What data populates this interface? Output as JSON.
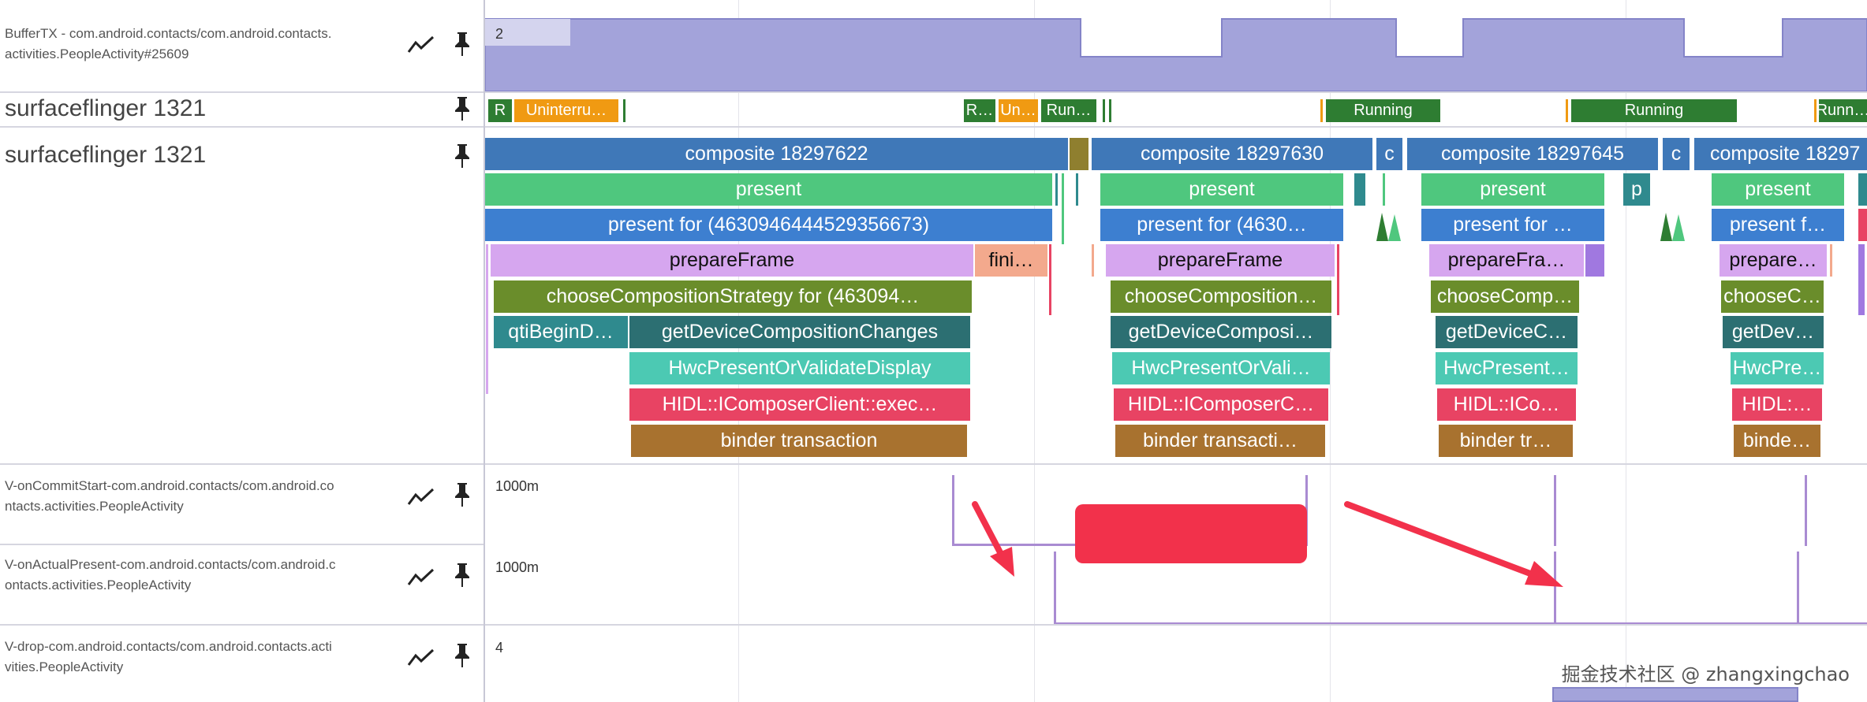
{
  "tracks": {
    "buffertx": {
      "label": "BufferTX - com.android.contacts/com.android.contacts.activities.PeopleActivity#25609",
      "label_line1": "BufferTX - com.android.contacts/com.android.contacts.",
      "label_line2": "activities.PeopleActivity#25609",
      "value": "2"
    },
    "sf_state": {
      "label": "surfaceflinger 1321",
      "states": [
        {
          "text": "R",
          "color": "#2e7d32"
        },
        {
          "text": "Uninterru…",
          "color": "#f09a12"
        },
        {
          "text": "R…",
          "color": "#2e7d32"
        },
        {
          "text": "Un…",
          "color": "#f09a12"
        },
        {
          "text": "Run…",
          "color": "#2e7d32"
        },
        {
          "text": "Running",
          "color": "#2e7d32"
        },
        {
          "text": "Running",
          "color": "#2e7d32"
        },
        {
          "text": "Runn…",
          "color": "#2e7d32"
        }
      ]
    },
    "sf_slices": {
      "label": "surfaceflinger 1321",
      "composite": [
        "composite 18297622",
        "composite 18297630",
        "c",
        "composite 18297645",
        "c",
        "composite 18297"
      ],
      "present": [
        "present",
        "present",
        "present",
        "p",
        "present"
      ],
      "present_for": [
        "present for  (4630946444529356673)",
        "present for  (4630…",
        "present for  …",
        "present f…"
      ],
      "prepare": [
        "prepareFrame",
        "fini…",
        "prepareFrame",
        "prepareFra…",
        "prepare…"
      ],
      "choose": [
        "chooseCompositionStrategy for  (463094…",
        "chooseComposition…",
        "chooseComp…",
        "chooseC…"
      ],
      "qti": [
        "qtiBeginD…"
      ],
      "getdev": [
        "getDeviceCompositionChanges",
        "getDeviceComposi…",
        "getDeviceC…",
        "getDev…"
      ],
      "hwc": [
        "HwcPresentOrValidateDisplay",
        "HwcPresentOrVali…",
        "HwcPresent…",
        "HwcPre…"
      ],
      "hidl": [
        "HIDL::IComposerClient::exec…",
        "HIDL::IComposerC…",
        "HIDL::ICo…",
        "HIDL:…"
      ],
      "binder": [
        "binder transaction",
        "binder transacti…",
        "binder tr…",
        "binde…"
      ]
    },
    "commit": {
      "label": "V-onCommitStart-com.android.contacts/com.android.contacts.activities.PeopleActivity",
      "label_line1": "V-onCommitStart-com.android.contacts/com.android.co",
      "label_line2": "ntacts.activities.PeopleActivity",
      "value": "1000m"
    },
    "present": {
      "label": "V-onActualPresent-com.android.contacts/com.android.contacts.activities.PeopleActivity",
      "label_line1": "V-onActualPresent-com.android.contacts/com.android.c",
      "label_line2": "ontacts.activities.PeopleActivity",
      "value": "1000m"
    },
    "drop": {
      "label": "V-drop-com.android.contacts/com.android.contacts.activities.PeopleActivity",
      "label_line1": "V-drop-com.android.contacts/com.android.contacts.acti",
      "label_line2": "vities.PeopleActivity",
      "value": "4"
    }
  },
  "watermark": "掘金技术社区 @ zhangxingchao",
  "colors": {
    "counter_fill": "#a3a3da",
    "composite": "#3f78b8",
    "present": "#4fc77e",
    "present_for": "#3d7fd0",
    "prepare": "#d6a6ef",
    "finish": "#f3a98d",
    "choose": "#6a8d2b",
    "qti": "#2f8a8e",
    "getdev": "#2c6f72",
    "hwc": "#4cc9b3",
    "hidl": "#e84363",
    "binder": "#a8722f",
    "annotation": "#f2314b"
  }
}
